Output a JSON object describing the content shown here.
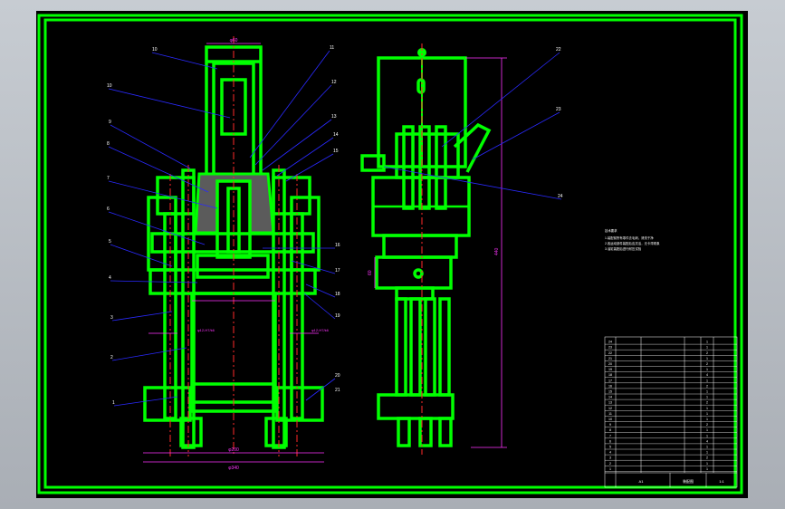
{
  "colors": {
    "background": "#000000",
    "frame": "#00ff00",
    "part": "#00ff00",
    "leader": "#2a2aff",
    "center_line": "#ff2a2a",
    "dimension": "#ff33ff",
    "text": "#ffffff",
    "section_hatch": "#8a8a8a"
  },
  "front_view": {
    "top_dimension": "φ60",
    "bottom_dimension_1": "φ200",
    "bottom_dimension_2": "φ340",
    "left_callout": "φ12-H7/k6",
    "right_callout": "φ12-H7/k6",
    "left_labels": [
      "10",
      "10",
      "9",
      "8",
      "7",
      "6",
      "5",
      "4",
      "3",
      "2",
      "1"
    ],
    "right_labels": [
      "11",
      "12",
      "13",
      "14",
      "15",
      "16",
      "17",
      "18",
      "19",
      "20",
      "21"
    ]
  },
  "side_view": {
    "right_labels": [
      "22",
      "23",
      "24"
    ],
    "height_dimension": "440",
    "side_dimension": "60"
  },
  "notes": [
    "技术要求",
    "1.装配前所有零件去毛刺，清洗干净",
    "2.各运动部件装配后应灵活，无卡滞现象",
    "3.油缸装配后进行耐压试验"
  ],
  "bom": {
    "rows": [
      [
        "24",
        "",
        "",
        "1",
        ""
      ],
      [
        "23",
        "",
        "",
        "1",
        ""
      ],
      [
        "22",
        "",
        "",
        "2",
        ""
      ],
      [
        "21",
        "",
        "",
        "1",
        ""
      ],
      [
        "20",
        "",
        "",
        "2",
        ""
      ],
      [
        "19",
        "",
        "",
        "1",
        ""
      ],
      [
        "18",
        "",
        "",
        "4",
        ""
      ],
      [
        "17",
        "",
        "",
        "1",
        ""
      ],
      [
        "16",
        "",
        "",
        "2",
        ""
      ],
      [
        "15",
        "",
        "",
        "1",
        ""
      ],
      [
        "14",
        "",
        "",
        "1",
        ""
      ],
      [
        "13",
        "",
        "",
        "2",
        ""
      ],
      [
        "12",
        "",
        "",
        "1",
        ""
      ],
      [
        "11",
        "",
        "",
        "1",
        ""
      ],
      [
        "10",
        "",
        "",
        "1",
        ""
      ],
      [
        "9",
        "",
        "",
        "2",
        ""
      ],
      [
        "8",
        "",
        "",
        "1",
        ""
      ],
      [
        "7",
        "",
        "",
        "1",
        ""
      ],
      [
        "6",
        "",
        "",
        "4",
        ""
      ],
      [
        "5",
        "",
        "",
        "1",
        ""
      ],
      [
        "4",
        "",
        "",
        "1",
        ""
      ],
      [
        "3",
        "",
        "",
        "2",
        ""
      ],
      [
        "2",
        "",
        "",
        "1",
        ""
      ],
      [
        "1",
        "",
        "",
        "1",
        ""
      ]
    ],
    "header": [
      "序号",
      "代号",
      "名称",
      "数量",
      "备注"
    ]
  },
  "title_block": {
    "name": "装配图",
    "scale": "1:1",
    "sheet": "A1"
  }
}
